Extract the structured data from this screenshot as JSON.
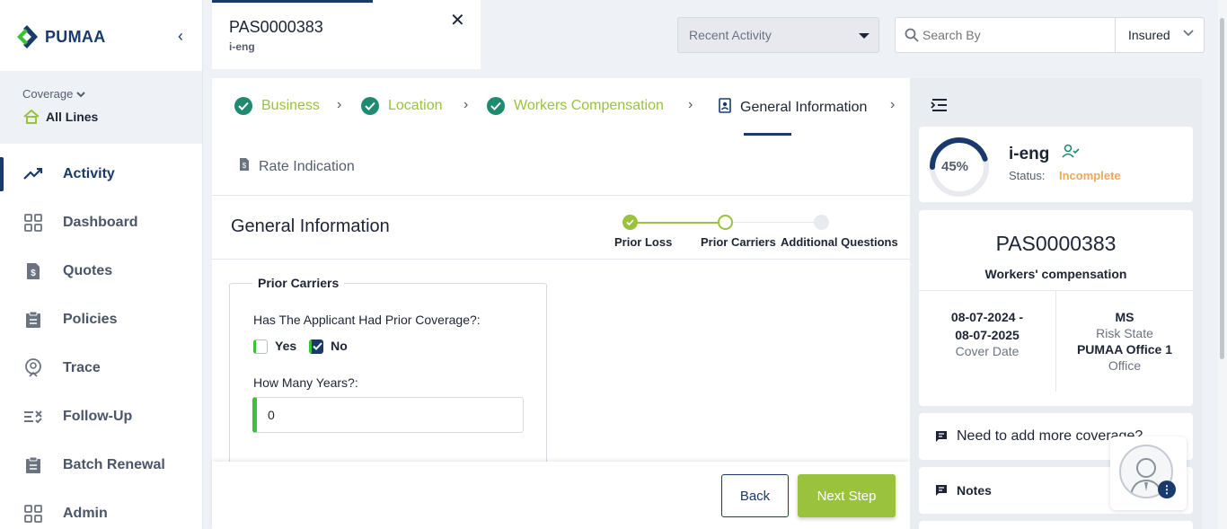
{
  "app": {
    "brand": "PUMAA"
  },
  "sidebar": {
    "coverage_label": "Coverage",
    "coverage_value": "All Lines",
    "items": [
      {
        "label": "Activity",
        "icon": "trend-icon",
        "active": true
      },
      {
        "label": "Dashboard",
        "icon": "grid-icon"
      },
      {
        "label": "Quotes",
        "icon": "quote-icon"
      },
      {
        "label": "Policies",
        "icon": "clipboard-icon"
      },
      {
        "label": "Trace",
        "icon": "location-icon"
      },
      {
        "label": "Follow-Up",
        "icon": "checklist-icon"
      },
      {
        "label": "Batch Renewal",
        "icon": "clipboard-icon"
      },
      {
        "label": "Admin",
        "icon": "grid-icon"
      }
    ]
  },
  "tab": {
    "title": "PAS0000383",
    "subtitle": "i-eng"
  },
  "header": {
    "recent_activity": "Recent Activity",
    "search_placeholder": "Search By",
    "search_type": "Insured"
  },
  "steps": {
    "business": "Business",
    "location": "Location",
    "workers_comp": "Workers Compensation",
    "general_info": "General Information",
    "rate_indication": "Rate Indication"
  },
  "form": {
    "title": "General Information",
    "progress": [
      "Prior Loss",
      "Prior Carriers",
      "Additional Questions"
    ],
    "section": "Prior Carriers",
    "q_prior": "Has The Applicant Had Prior Coverage?:",
    "opt_yes": "Yes",
    "opt_no": "No",
    "q_years": "How Many Years?:",
    "years_value": "0",
    "back": "Back",
    "next": "Next Step"
  },
  "summary": {
    "progress_pct": "45%",
    "progress_value": 0.45,
    "name": "i-eng",
    "status_label": "Status:",
    "status_value": "Incomplete",
    "policy_no": "PAS0000383",
    "policy_type": "Workers' compensation",
    "cover_date_1": "08-07-2024 -",
    "cover_date_2": "08-07-2025",
    "cover_date_label": "Cover Date",
    "state": "MS",
    "state_label": "Risk State",
    "office": "PUMAA Office 1",
    "office_label": "Office",
    "more_coverage": "Need to add more coverage?",
    "notes": "Notes"
  },
  "colors": {
    "brand": "#1a3a6b",
    "accent": "#9ac23c",
    "warn": "#f0a857",
    "check": "#1f8a70"
  }
}
